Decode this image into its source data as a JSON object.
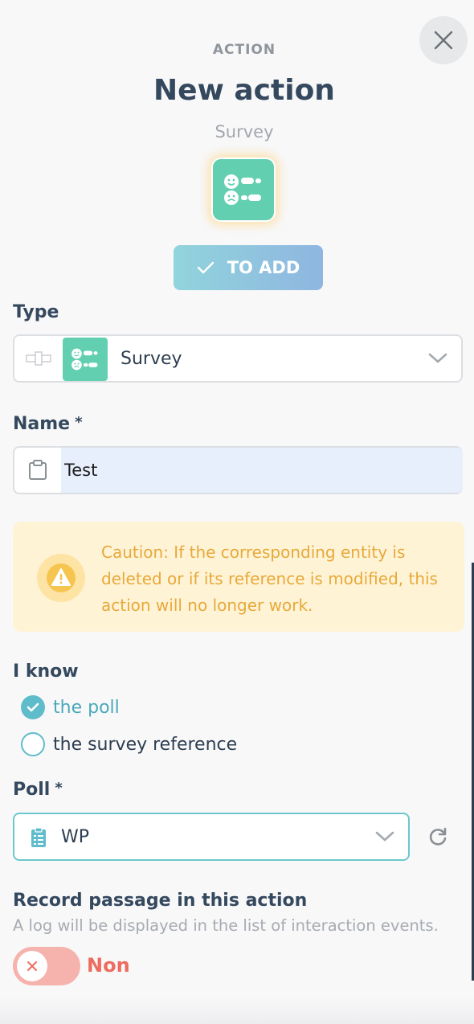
{
  "header": {
    "eyebrow": "ACTION",
    "title": "New action",
    "subtitle": "Survey",
    "badge_icon": "survey-icon",
    "badge_color": "#62d0b0",
    "add_button_label": "TO ADD",
    "close_icon": "close-icon"
  },
  "type_field": {
    "label": "Type",
    "value": "Survey",
    "icon": "survey-icon"
  },
  "name_field": {
    "label": "Name",
    "required_mark": "*",
    "value": "Test",
    "icon": "clipboard-icon"
  },
  "caution": {
    "icon": "warning-icon",
    "text": "Caution: If the corresponding entity is deleted or if its reference is modified, this action will no longer work.",
    "color": "#e7a93a",
    "background": "#fff3d6"
  },
  "i_know": {
    "label": "I know",
    "options": [
      {
        "label": "the poll",
        "checked": true
      },
      {
        "label": "the survey reference",
        "checked": false
      }
    ]
  },
  "poll_field": {
    "label": "Poll",
    "required_mark": "*",
    "value": "WP",
    "icon": "checklist-icon",
    "refresh_icon": "refresh-icon"
  },
  "record": {
    "label": "Record passage in this action",
    "help": "A log will be displayed in the list of interaction events.",
    "toggle_state": "Non",
    "toggle_on": false
  },
  "colors": {
    "accent": "#5fbccb",
    "heading": "#34485e",
    "toggle_off": "#ec6d5f"
  }
}
